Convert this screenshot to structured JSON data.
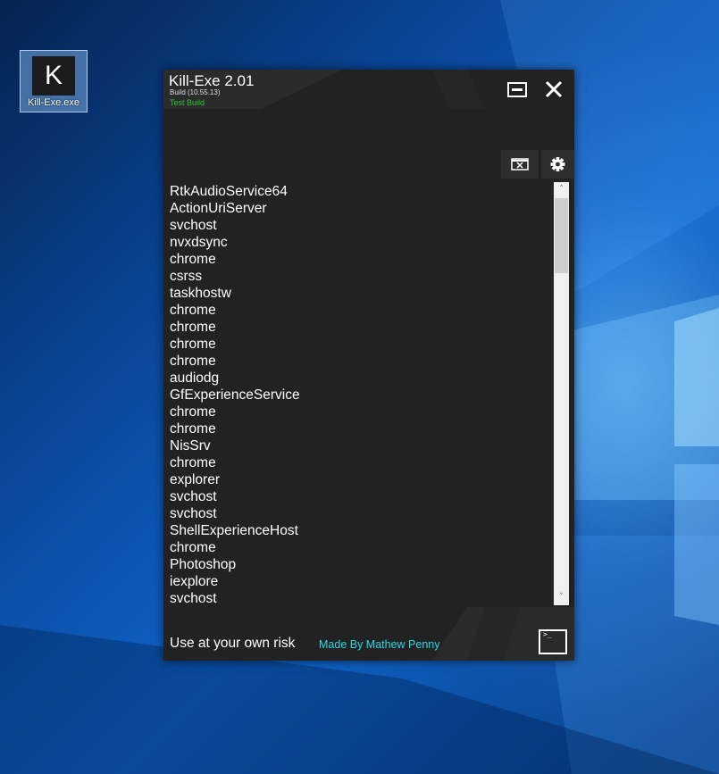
{
  "desktop": {
    "icon_glyph": "K",
    "icon_label": "Kill-Exe.exe"
  },
  "window": {
    "title": "Kill-Exe 2.01",
    "build": "Build (10.55.13)",
    "test_label": "Test Build",
    "minimize_icon": "minimize-icon",
    "close_icon": "close-icon",
    "accent_test_color": "#31c431"
  },
  "toolbar": {
    "clear_icon": "clear-list-icon",
    "settings_icon": "gear-icon"
  },
  "processes": [
    "RtkAudioService64",
    "ActionUriServer",
    "svchost",
    "nvxdsync",
    "chrome",
    "csrss",
    "taskhostw",
    "chrome",
    "chrome",
    "chrome",
    "chrome",
    "audiodg",
    "GfExperienceService",
    "chrome",
    "chrome",
    "NisSrv",
    "chrome",
    "explorer",
    "svchost",
    "svchost",
    "ShellExperienceHost",
    "chrome",
    "Photoshop",
    "iexplore",
    "svchost"
  ],
  "scrollbar": {
    "up_arrow": "˄",
    "down_arrow": "˅",
    "position_fraction": 0.0
  },
  "footer": {
    "warning": "Use at your own risk",
    "credit": "Made By Mathew Penny",
    "credit_color": "#2fd6e6",
    "console_icon": "console-icon",
    "console_glyph": ">_"
  }
}
